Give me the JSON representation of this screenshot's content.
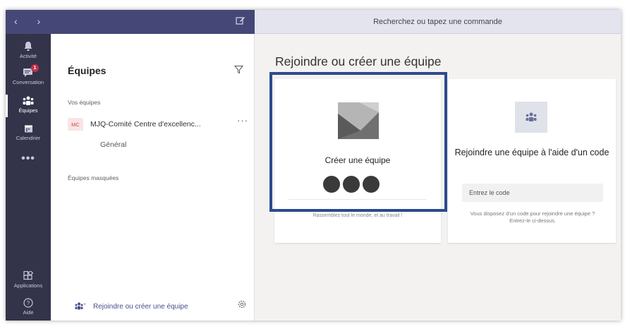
{
  "topbar": {
    "nav_arrows": "‹ ›",
    "search_placeholder": "Recherchez ou tapez une commande"
  },
  "rail": {
    "items": [
      {
        "label": "Activité",
        "icon": "bell-icon"
      },
      {
        "label": "Conversation",
        "icon": "chat-icon",
        "badge": "1"
      },
      {
        "label": "Équipes",
        "icon": "teams-icon",
        "active": true
      },
      {
        "label": "Calendrier",
        "icon": "calendar-icon"
      },
      {
        "label": "•••",
        "icon": "more-icon"
      },
      {
        "label": "Applications",
        "icon": "apps-icon"
      },
      {
        "label": "Aide",
        "icon": "help-icon"
      }
    ]
  },
  "panel": {
    "title": "Équipes",
    "your_teams_label": "Vos équipes",
    "team": {
      "initials": "MC",
      "name": "MJQ-Comité Centre d'excellenc...",
      "more": "···"
    },
    "channel": "Général",
    "hidden_teams_label": "Équipes masquées",
    "join_create_label": "Rejoindre ou créer une équipe"
  },
  "main": {
    "title": "Rejoindre ou créer une équipe",
    "create_card": {
      "title": "Créer une équipe",
      "subtitle": "Rassemblez tout le monde, et au travail !"
    },
    "join_card": {
      "title": "Rejoindre une équipe à l'aide d'un code",
      "input_placeholder": "Entrez le code",
      "help": "Vous disposez d'un code pour rejoindre une équipe ? Entrez-le ci-dessus."
    }
  },
  "colors": {
    "rail_bg": "#33344a",
    "topbar_left_bg": "#454776",
    "highlight_border": "#2b4b8e",
    "badge": "#c4314b"
  }
}
